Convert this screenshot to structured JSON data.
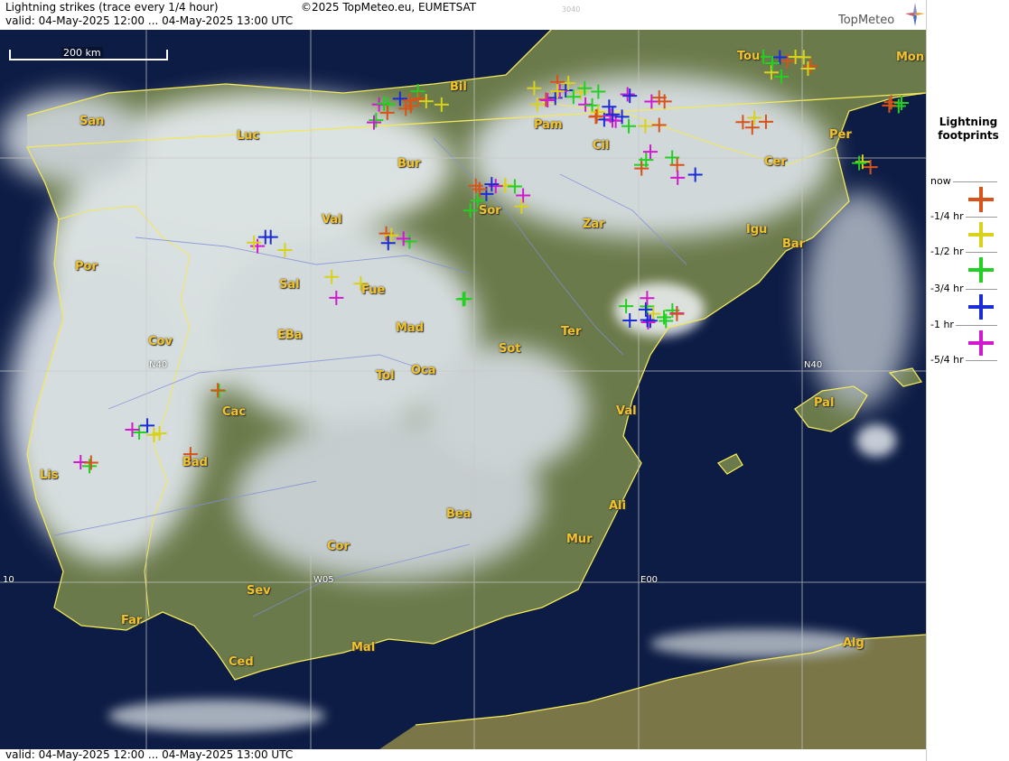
{
  "header": {
    "title": "Lightning strikes (trace every 1/4 hour)",
    "copyright": "©2025 TopMeteo.eu, EUMETSAT",
    "valid": "valid:  04-May-2025 12:00 ... 04-May-2025 13:00 UTC",
    "code": "3040",
    "brand": "TopMeteo"
  },
  "footer": {
    "valid": "valid:  04-May-2025 12:00 ... 04-May-2025 13:00 UTC"
  },
  "scale": {
    "label": "200 km"
  },
  "grid_labels": [
    "N40",
    "N40",
    "W05",
    "E00",
    "10"
  ],
  "legend": {
    "title_line1": "Lightning",
    "title_line2": "footprints",
    "items": [
      {
        "label": "now",
        "color": "#d8531a"
      },
      {
        "label": "-1/4 hr",
        "color": "#d8d21a"
      },
      {
        "label": "-1/2 hr",
        "color": "#22d022"
      },
      {
        "label": "-3/4 hr",
        "color": "#1a2cd8"
      },
      {
        "label": "-1 hr",
        "color": "#d01ad0"
      },
      {
        "label": "-5/4 hr",
        "color": ""
      }
    ]
  },
  "cities": [
    "San",
    "Luc",
    "Bur",
    "Bil",
    "Pam",
    "Cil",
    "Tou",
    "Mon",
    "Per",
    "Cer",
    "Val",
    "Sor",
    "Zar",
    "Igu",
    "Bar",
    "Por",
    "Sal",
    "Fue",
    "Mad",
    "EBa",
    "Cov",
    "Tol",
    "Oca",
    "Sot",
    "Ter",
    "Cac",
    "Val",
    "Bad",
    "Lis",
    "Pal",
    "Bea",
    "Ali",
    "Cor",
    "Mur",
    "Sev",
    "Far",
    "Mal",
    "Ced",
    "Alg"
  ]
}
